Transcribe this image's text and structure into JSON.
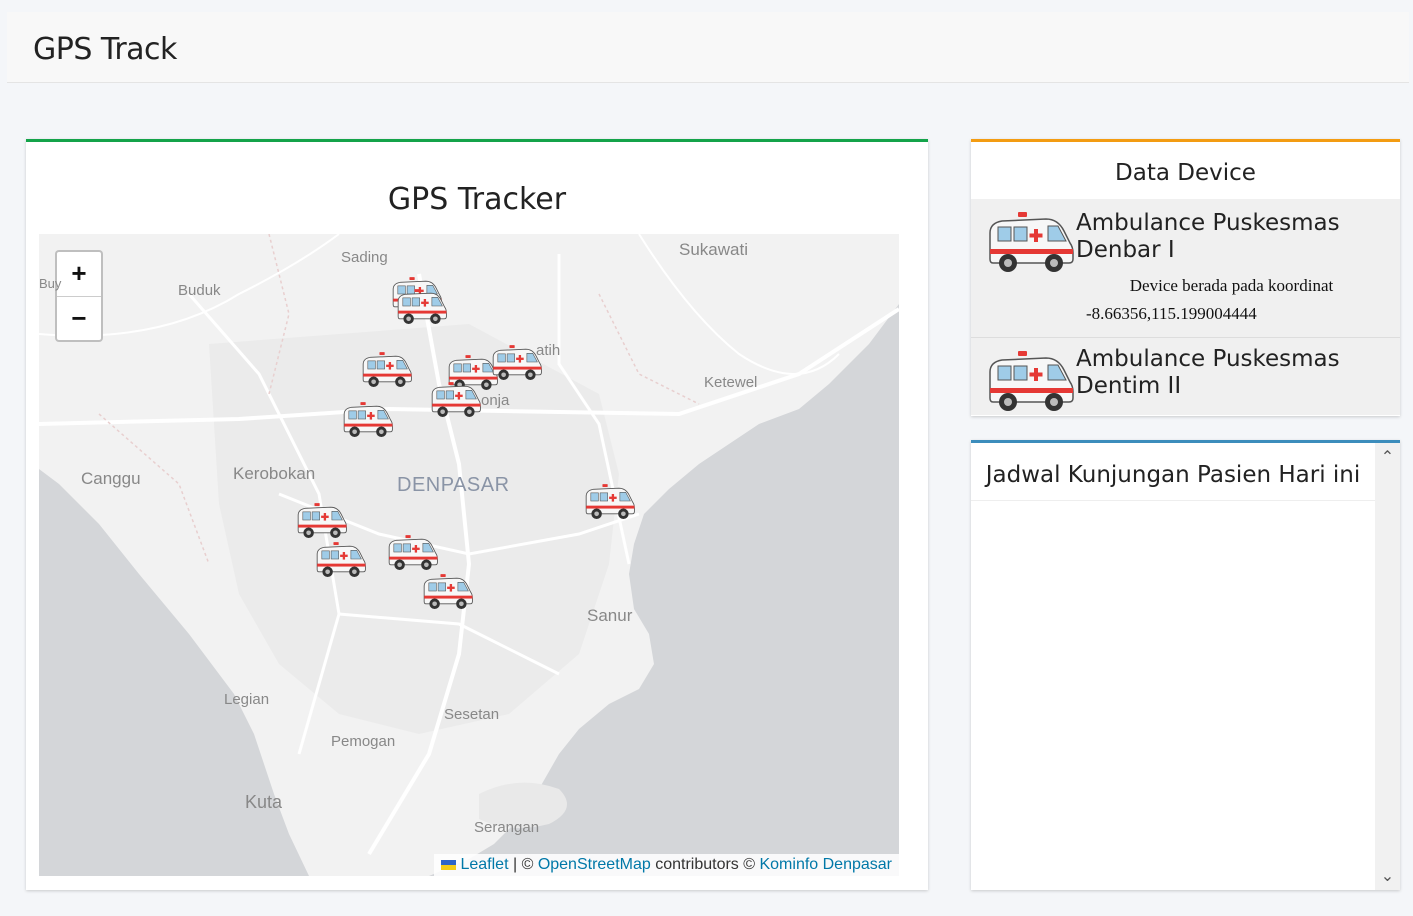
{
  "page": {
    "title": "GPS Track"
  },
  "map_card": {
    "title": "GPS Tracker",
    "zoom_in": "+",
    "zoom_out": "−",
    "labels": {
      "sading": "Sading",
      "sukawati": "Sukawati",
      "buduk": "Buduk",
      "buy": "Buy",
      "batubulan": "atih",
      "ketewel": "Ketewel",
      "peguyangan": "onja",
      "canggu": "Canggu",
      "kerobokan": "Kerobokan",
      "denpasar": "DENPASAR",
      "sanur": "Sanur",
      "legian": "Legian",
      "sesetan": "Sesetan",
      "pemogan": "Pemogan",
      "kuta": "Kuta",
      "serangan": "Serangan"
    },
    "attribution": {
      "leaflet": "Leaflet",
      "sep1": " | © ",
      "osm": "OpenStreetMap",
      "contrib": " contributors © ",
      "kominfo": "Kominfo Denpasar"
    }
  },
  "device_card": {
    "title": "Data Device",
    "devices": [
      {
        "name_line1": "Ambulance Puskesmas",
        "name_line2": "Denbar I",
        "coord_label": "Device berada pada koordinat",
        "coord": "-8.66356,115.199004444",
        "icon": "ambulance-icon"
      },
      {
        "name_line1": "Ambulance Puskesmas",
        "name_line2": "Dentim II",
        "icon": "ambulance-icon"
      }
    ]
  },
  "schedule_card": {
    "title": "Jadwal Kunjungan Pasien Hari ini",
    "scroll_up": "^",
    "scroll_down": "v"
  },
  "colors": {
    "map_accent": "#14a34a",
    "device_accent": "#f39c12",
    "schedule_accent": "#3c8dbc",
    "link": "#0078a8"
  }
}
